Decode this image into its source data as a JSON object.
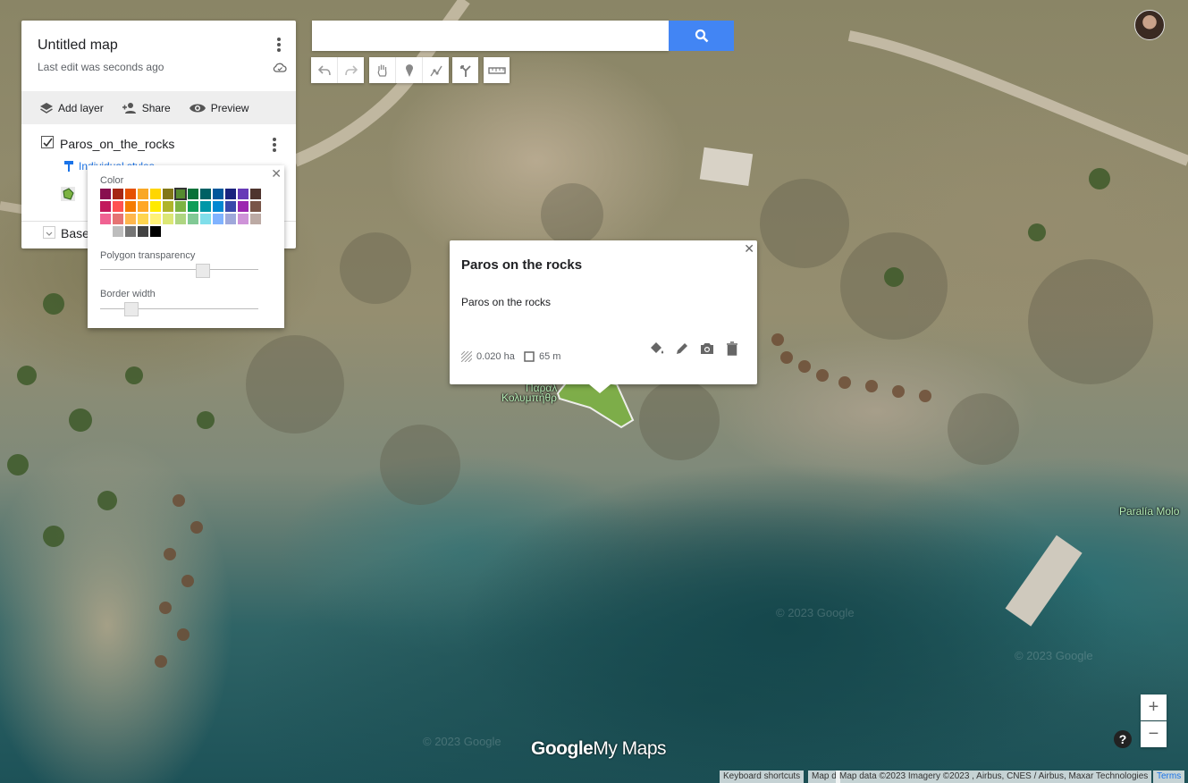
{
  "panel": {
    "title": "Untitled map",
    "subtitle": "Last edit was seconds ago",
    "actions": {
      "add_layer": "Add layer",
      "share": "Share",
      "preview": "Preview"
    },
    "layer": {
      "name": "Paros_on_the_rocks",
      "style_link": "Individual styles",
      "checked": true
    },
    "base_layer_label": "Base map"
  },
  "color_popup": {
    "color_label": "Color",
    "transparency_label": "Polygon transparency",
    "border_label": "Border width",
    "transparency_value": 0.65,
    "border_width_value": 0.2,
    "selected_color": "#558b2f",
    "colors": [
      "#880e4f",
      "#a52714",
      "#e65100",
      "#f9a825",
      "#ffd600",
      "#817717",
      "#558b2f",
      "#097138",
      "#006064",
      "#01579b",
      "#1a237e",
      "#673ab7",
      "#4e342e",
      "#c2185b",
      "#ff5252",
      "#f57c00",
      "#ffa726",
      "#ffea00",
      "#afb42b",
      "#7cb342",
      "#0f9d58",
      "#0097a7",
      "#0288d1",
      "#3949ab",
      "#9c27b0",
      "#795548",
      "#f06292",
      "#e57373",
      "#ffb74d",
      "#ffd54f",
      "#fff176",
      "#dce775",
      "#aed581",
      "#81c995",
      "#80deea",
      "#80b3ff",
      "#9fa8da",
      "#ce93d8",
      "#bcaaa4",
      "#ffffff",
      "#bdbdbd",
      "#757575",
      "#424242",
      "#000000"
    ]
  },
  "search": {
    "placeholder": ""
  },
  "toolbar": {
    "icons": [
      "undo-icon",
      "redo-icon",
      "hand-icon",
      "marker-icon",
      "line-icon",
      "directions-icon",
      "ruler-icon"
    ]
  },
  "info_card": {
    "title": "Paros on the rocks",
    "description": "Paros on the rocks",
    "area": "0.020 ha",
    "perimeter": "65 m"
  },
  "map": {
    "place_label_1": "Παραλ",
    "place_label_2": "Κολυμπήθρ",
    "beach_label": "Paralía Molo",
    "watermark": "© 2023 Google",
    "polygon_color": "#7cb342"
  },
  "zoom": {
    "in": "+",
    "out": "−"
  },
  "help": "?",
  "footer": {
    "logo_google": "Google",
    "logo_mymaps": "My Maps",
    "shortcuts": "Keyboard shortcuts",
    "map_data_short": "Map d",
    "attribution": "Map data ©2023 Imagery ©2023 , Airbus, CNES / Airbus, Maxar Technologies",
    "terms": "Terms"
  }
}
